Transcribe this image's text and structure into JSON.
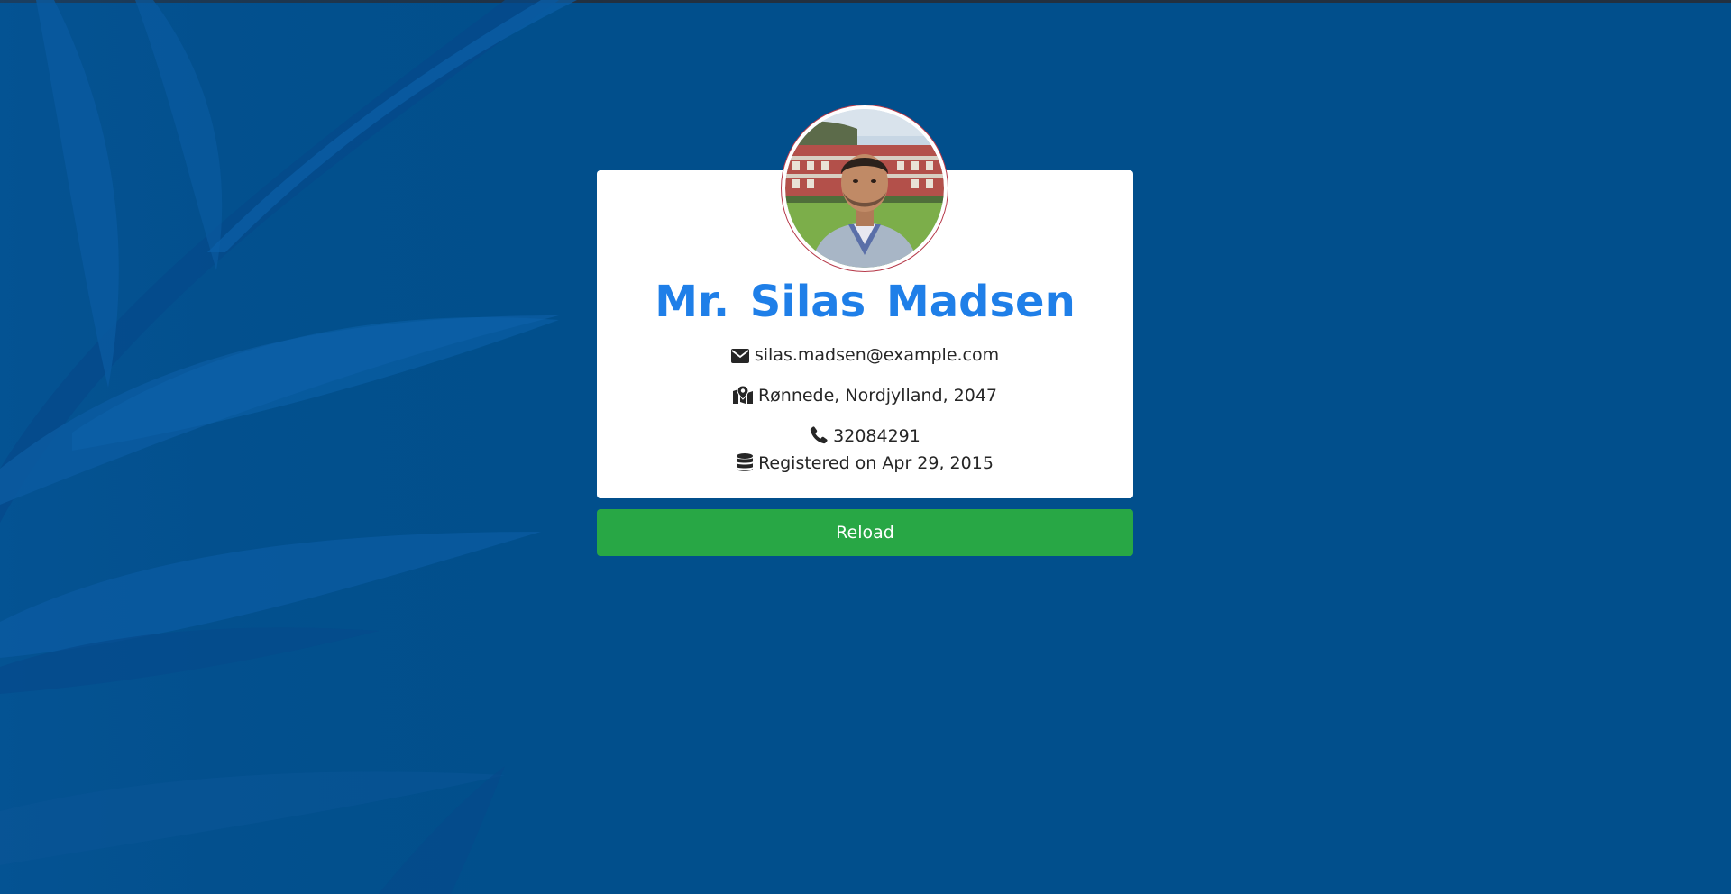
{
  "profile": {
    "name": "Mr. Silas Madsen",
    "email": "silas.madsen@example.com",
    "location": "Rønnede, Nordjylland, 2047",
    "phone": "32084291",
    "registered": "Registered on Apr 29, 2015"
  },
  "actions": {
    "reload_label": "Reload"
  },
  "icons": {
    "email": "envelope-icon",
    "location": "map-marker-icon",
    "phone": "phone-icon",
    "registered": "database-icon"
  },
  "colors": {
    "background": "#014f8c",
    "name": "#1f7fe8",
    "reload_button": "#28a745",
    "avatar_border": "#b63a4a"
  }
}
